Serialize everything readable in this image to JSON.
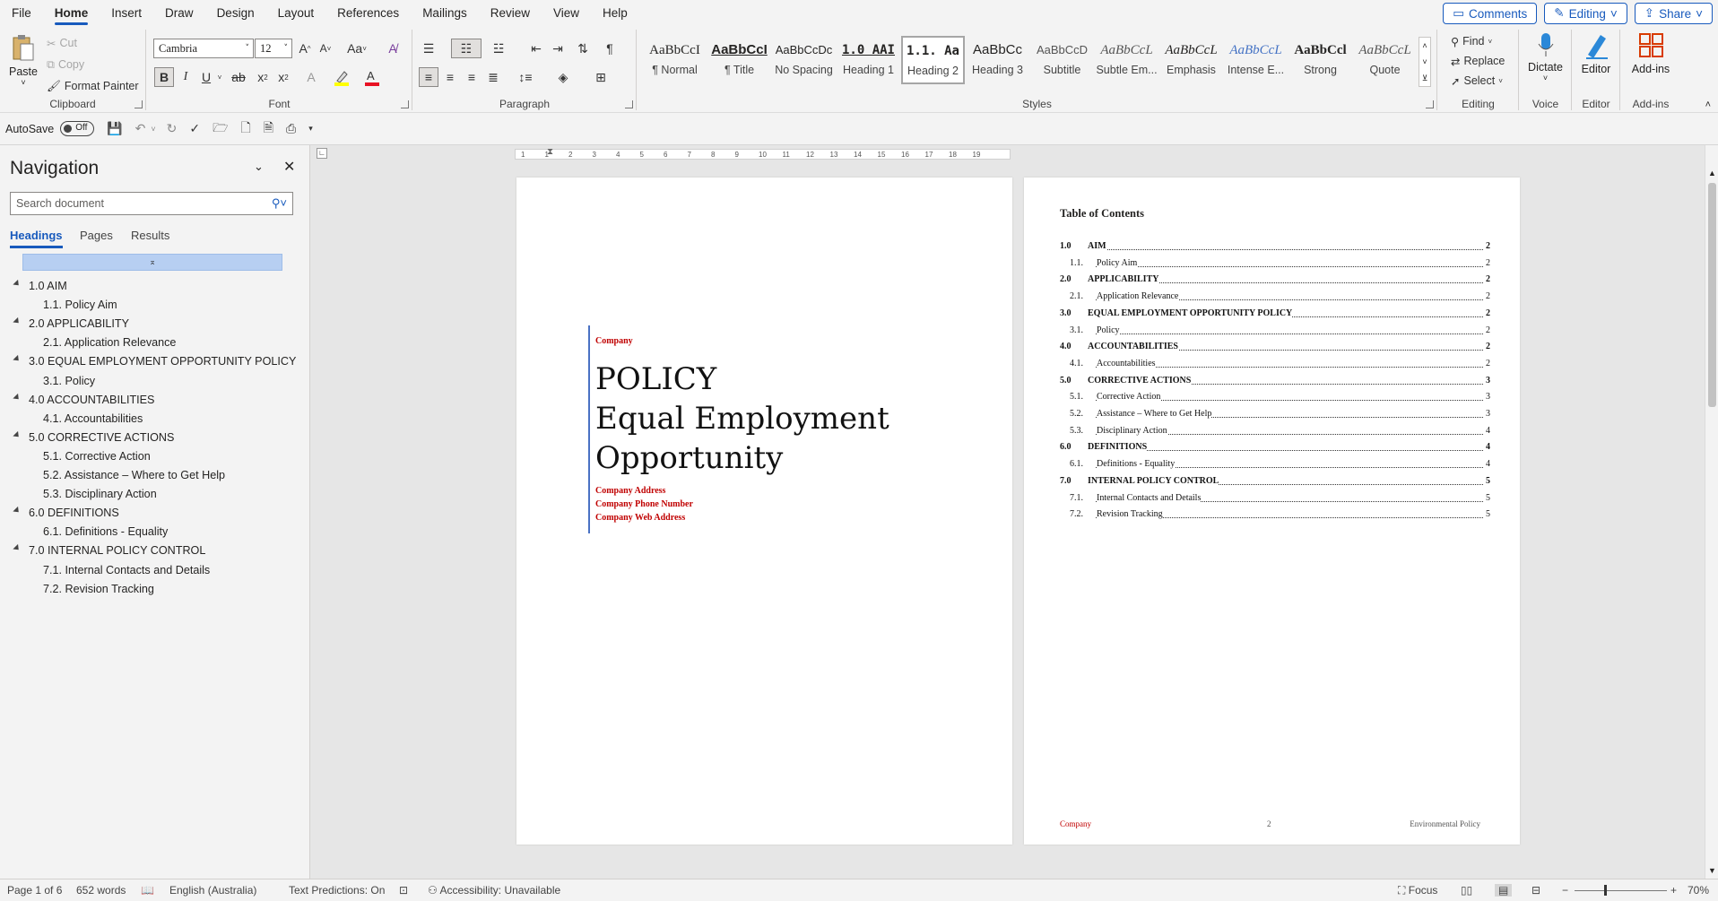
{
  "menu": {
    "tabs": [
      "File",
      "Home",
      "Insert",
      "Draw",
      "Design",
      "Layout",
      "References",
      "Mailings",
      "Review",
      "View",
      "Help"
    ],
    "active": "Home",
    "comments": "Comments",
    "editing": "Editing",
    "share": "Share"
  },
  "ribbon": {
    "clipboard": {
      "paste": "Paste",
      "cut": "Cut",
      "copy": "Copy",
      "format_painter": "Format Painter",
      "label": "Clipboard"
    },
    "font": {
      "name": "Cambria",
      "size": "12",
      "label": "Font",
      "grow": "A^",
      "shrink": "A˅",
      "case": "Aa"
    },
    "paragraph": {
      "label": "Paragraph"
    },
    "styles": {
      "label": "Styles",
      "items": [
        {
          "preview": "AaBbCcI",
          "name": "¶ Normal"
        },
        {
          "preview": "AaBbCcI",
          "name": "¶ Title"
        },
        {
          "preview": "AaBbCcDc",
          "name": "No Spacing"
        },
        {
          "preview": "1.0 AAI",
          "name": "Heading 1"
        },
        {
          "preview": "1.1. Aa",
          "name": "Heading 2"
        },
        {
          "preview": "AaBbCc",
          "name": "Heading 3"
        },
        {
          "preview": "AaBbCcD",
          "name": "Subtitle"
        },
        {
          "preview": "AaBbCcL",
          "name": "Subtle Em..."
        },
        {
          "preview": "AaBbCcL",
          "name": "Emphasis"
        },
        {
          "preview": "AaBbCcL",
          "name": "Intense E..."
        },
        {
          "preview": "AaBbCcl",
          "name": "Strong"
        },
        {
          "preview": "AaBbCcL",
          "name": "Quote"
        }
      ],
      "selected_index": 4
    },
    "editing": {
      "find": "Find",
      "replace": "Replace",
      "select": "Select",
      "label": "Editing"
    },
    "voice": {
      "dictate": "Dictate",
      "label": "Voice"
    },
    "editor": {
      "editor": "Editor",
      "label": "Editor"
    },
    "addins": {
      "addins": "Add-ins",
      "label": "Add-ins"
    }
  },
  "qat": {
    "autosave": "AutoSave",
    "toggle": "Off"
  },
  "navigation": {
    "title": "Navigation",
    "search_placeholder": "Search document",
    "tabs": [
      "Headings",
      "Pages",
      "Results"
    ],
    "headings": [
      {
        "text": "1.0 AIM",
        "level": 1
      },
      {
        "text": "1.1. Policy Aim",
        "level": 2
      },
      {
        "text": "2.0 APPLICABILITY",
        "level": 1
      },
      {
        "text": "2.1. Application Relevance",
        "level": 2
      },
      {
        "text": "3.0 EQUAL EMPLOYMENT OPPORTUNITY POLICY",
        "level": 1
      },
      {
        "text": "3.1. Policy",
        "level": 2
      },
      {
        "text": "4.0 ACCOUNTABILITIES",
        "level": 1
      },
      {
        "text": "4.1. Accountabilities",
        "level": 2
      },
      {
        "text": "5.0 CORRECTIVE ACTIONS",
        "level": 1
      },
      {
        "text": "5.1. Corrective Action",
        "level": 2
      },
      {
        "text": "5.2. Assistance – Where to Get Help",
        "level": 2
      },
      {
        "text": "5.3. Disciplinary Action",
        "level": 2
      },
      {
        "text": "6.0 DEFINITIONS",
        "level": 1
      },
      {
        "text": "6.1. Definitions - Equality",
        "level": 2
      },
      {
        "text": "7.0 INTERNAL POLICY CONTROL",
        "level": 1
      },
      {
        "text": "7.1. Internal Contacts and Details",
        "level": 2
      },
      {
        "text": "7.2. Revision Tracking",
        "level": 2
      }
    ]
  },
  "ruler": {
    "numbers": [
      "1",
      "1",
      "2",
      "3",
      "4",
      "5",
      "6",
      "7",
      "8",
      "9",
      "10",
      "11",
      "12",
      "13",
      "14",
      "15",
      "16",
      "17",
      "18",
      "19"
    ]
  },
  "page1": {
    "company": "Company",
    "title_line1": "POLICY",
    "title_line2": "Equal Employment",
    "title_line3": "Opportunity",
    "address": "Company Address",
    "phone": "Company Phone Number",
    "web": "Company Web Address"
  },
  "page2": {
    "toc_title": "Table of Contents",
    "toc": [
      {
        "num": "1.0",
        "text": "AIM",
        "page": "2",
        "level": 1
      },
      {
        "num": "1.1.",
        "text": "Policy Aim",
        "page": "2",
        "level": 2
      },
      {
        "num": "2.0",
        "text": "APPLICABILITY",
        "page": "2",
        "level": 1
      },
      {
        "num": "2.1.",
        "text": "Application Relevance",
        "page": "2",
        "level": 2
      },
      {
        "num": "3.0",
        "text": "EQUAL EMPLOYMENT OPPORTUNITY POLICY",
        "page": "2",
        "level": 1
      },
      {
        "num": "3.1.",
        "text": "Policy",
        "page": "2",
        "level": 2
      },
      {
        "num": "4.0",
        "text": "ACCOUNTABILITIES",
        "page": "2",
        "level": 1
      },
      {
        "num": "4.1.",
        "text": "Accountabilities",
        "page": "2",
        "level": 2
      },
      {
        "num": "5.0",
        "text": "CORRECTIVE ACTIONS",
        "page": "3",
        "level": 1
      },
      {
        "num": "5.1.",
        "text": "Corrective Action",
        "page": "3",
        "level": 2
      },
      {
        "num": "5.2.",
        "text": "Assistance – Where to Get Help",
        "page": "3",
        "level": 2
      },
      {
        "num": "5.3.",
        "text": "Disciplinary Action",
        "page": "4",
        "level": 2
      },
      {
        "num": "6.0",
        "text": "DEFINITIONS",
        "page": "4",
        "level": 1
      },
      {
        "num": "6.1.",
        "text": "Definitions - Equality",
        "page": "4",
        "level": 2
      },
      {
        "num": "7.0",
        "text": "INTERNAL POLICY CONTROL",
        "page": "5",
        "level": 1
      },
      {
        "num": "7.1.",
        "text": "Internal Contacts and Details",
        "page": "5",
        "level": 2
      },
      {
        "num": "7.2.",
        "text": "Revision Tracking",
        "page": "5",
        "level": 2
      }
    ],
    "footer_left": "Company",
    "footer_center": "2",
    "footer_right": "Environmental Policy"
  },
  "status": {
    "page": "Page 1 of 6",
    "words": "652 words",
    "language": "English (Australia)",
    "predictions": "Text Predictions: On",
    "accessibility": "Accessibility: Unavailable",
    "focus": "Focus",
    "zoom": "70%"
  },
  "colors": {
    "accent": "#185abd",
    "company_red": "#c00000",
    "page_bg": "#ffffff"
  }
}
